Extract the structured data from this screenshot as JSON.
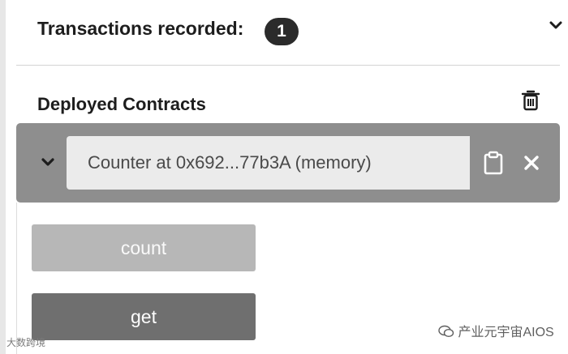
{
  "transactions": {
    "label": "Transactions recorded:",
    "count": "1",
    "toggle_icon": "chevron-down-icon"
  },
  "deployed": {
    "title": "Deployed Contracts",
    "clear_icon": "trash-icon",
    "contract": {
      "address_label": "Counter at 0x692...77b3A (memory)",
      "expand_icon": "chevron-down-icon",
      "copy_icon": "clipboard-icon",
      "remove_icon": "close-icon",
      "functions": [
        {
          "label": "count"
        },
        {
          "label": "get"
        }
      ]
    }
  },
  "watermarks": {
    "right": "产业元宇宙AIOS",
    "left": "大数跨境"
  },
  "colors": {
    "contract_bar": "#8e8e8e",
    "address_box": "#ebebeb",
    "count_button": "#b7b7b7",
    "get_button": "#6f6f6f",
    "badge": "#2b2b2b"
  }
}
